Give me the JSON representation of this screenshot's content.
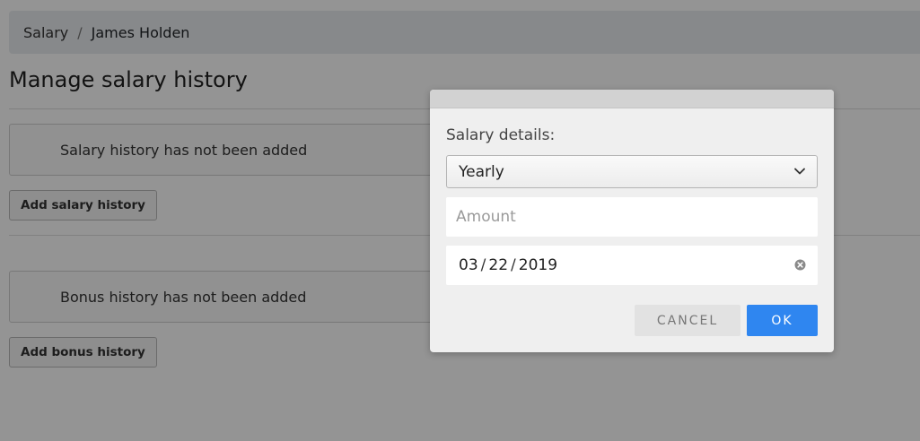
{
  "breadcrumb": {
    "parent": "Salary",
    "separator": "/",
    "current": "James Holden"
  },
  "page": {
    "title": "Manage salary history"
  },
  "salary_section": {
    "empty_message": "Salary history has not been added",
    "add_button": "Add salary history"
  },
  "bonus_section": {
    "empty_message": "Bonus history has not been added",
    "add_button": "Add bonus history"
  },
  "modal": {
    "label": "Salary details:",
    "frequency_select": {
      "selected": "Yearly",
      "icon": "chevron-down-icon"
    },
    "amount_input": {
      "value": "",
      "placeholder": "Amount"
    },
    "date_input": {
      "month": "03",
      "day": "22",
      "year": "2019",
      "clear_icon": "clear-circle-icon"
    },
    "cancel_label": "CANCEL",
    "ok_label": "OK"
  },
  "colors": {
    "overlay": "rgba(0,0,0,0.42)",
    "ok_button": "#2f86f0",
    "cancel_button": "#e2e2e2",
    "modal_bg": "#efefef"
  }
}
